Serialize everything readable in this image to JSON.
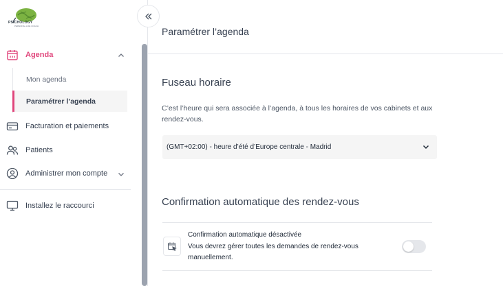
{
  "brand": {
    "name": "PSICHOLOGY",
    "tagline": "PERSONAL LIFE COACH"
  },
  "collapse": {
    "icon": "double-chevron-left-icon"
  },
  "sidebar": {
    "items": [
      {
        "label": "Agenda",
        "icon": "calendar-icon",
        "active": true,
        "expanded": true
      },
      {
        "label": "Facturation et paiements",
        "icon": "credit-card-icon"
      },
      {
        "label": "Patients",
        "icon": "users-icon"
      },
      {
        "label": "Administrer mon compte",
        "icon": "user-circle-icon"
      },
      {
        "label": "Installez le raccourci",
        "icon": "monitor-icon"
      }
    ],
    "sub_items": [
      {
        "label": "Mon agenda"
      },
      {
        "label": "Paramétrer l’agenda",
        "active": true
      }
    ]
  },
  "main": {
    "title": "Paramétrer l’agenda",
    "timezone": {
      "title": "Fuseau horaire",
      "description": "C’est l’heure qui sera associée à l’agenda, à tous les horaires de vos cabinets et aux rendez-vous.",
      "selected": "(GMT+02:00) - heure d’été d’Europe centrale - Madrid"
    },
    "confirmation": {
      "title": "Confirmation automatique des rendez-vous",
      "heading": "Confirmation automatique désactivée",
      "body": "Vous devrez gérer toutes les demandes de rendez-vous manuellement.",
      "enabled": false
    }
  },
  "colors": {
    "accent": "#e0457b",
    "text": "#374151",
    "muted": "#6b7280",
    "border": "#e5e7eb",
    "select_bg": "#f5f5f5",
    "logo_green": "#7cb342"
  }
}
